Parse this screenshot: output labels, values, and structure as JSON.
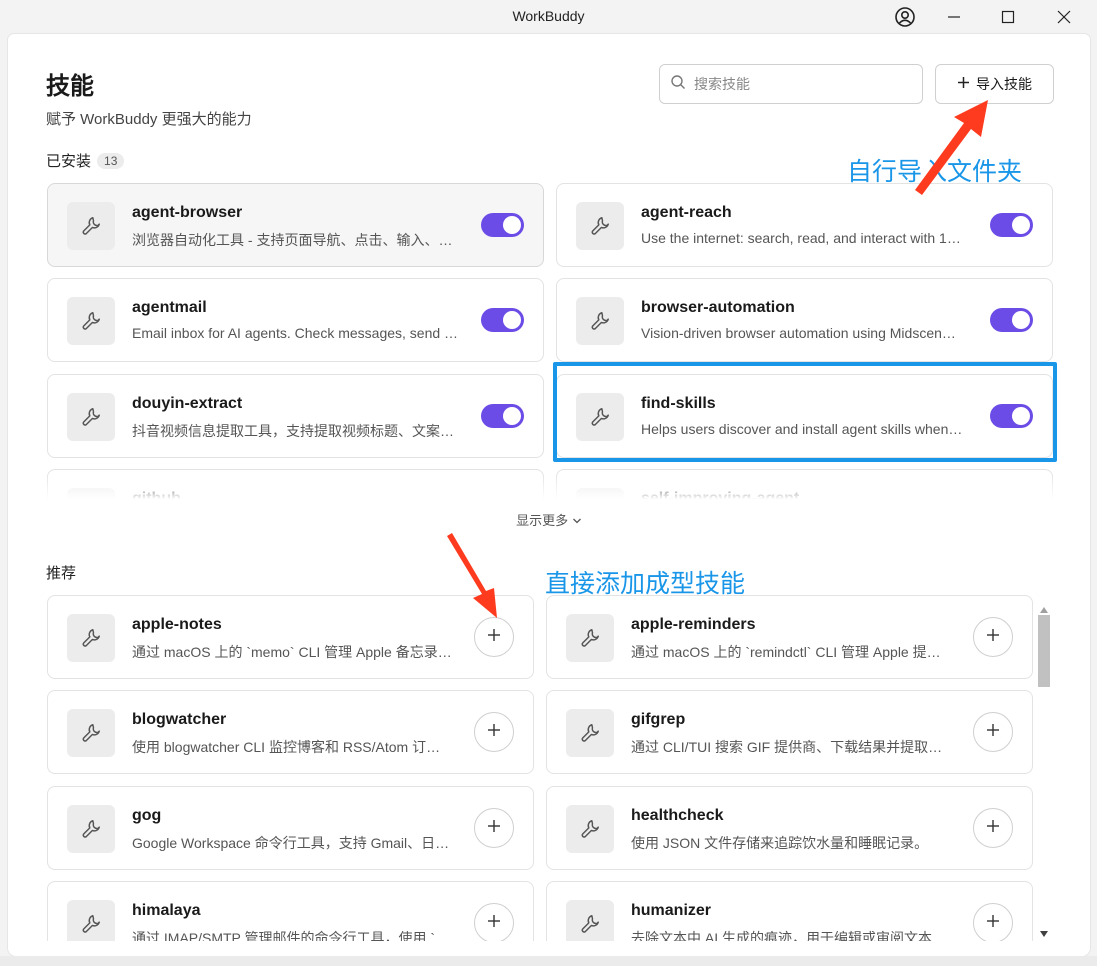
{
  "window": {
    "title": "WorkBuddy",
    "controls": [
      "account-icon",
      "minimize-icon",
      "maximize-icon",
      "close-icon"
    ]
  },
  "page": {
    "title": "技能",
    "subtitle": "赋予 WorkBuddy 更强大的能力"
  },
  "search": {
    "placeholder": "搜索技能",
    "value": ""
  },
  "import_button": {
    "label": "导入技能",
    "icon": "plus-icon"
  },
  "installed": {
    "label": "已安装",
    "count": "13",
    "items": [
      {
        "name": "agent-browser",
        "desc": "浏览器自动化工具 - 支持页面导航、点击、输入、…",
        "enabled": true
      },
      {
        "name": "agent-reach",
        "desc": "Use the internet: search, read, and interact with 1…",
        "enabled": true
      },
      {
        "name": "agentmail",
        "desc": "Email inbox for AI agents. Check messages, send …",
        "enabled": true
      },
      {
        "name": "browser-automation",
        "desc": "Vision-driven browser automation using Midscen…",
        "enabled": true
      },
      {
        "name": "douyin-extract",
        "desc": "抖音视频信息提取工具，支持提取视频标题、文案…",
        "enabled": true
      },
      {
        "name": "find-skills",
        "desc": "Helps users discover and install agent skills when…",
        "enabled": true
      },
      {
        "name": "github",
        "desc": "",
        "enabled": true
      },
      {
        "name": "self-improving-agent",
        "desc": "",
        "enabled": true
      }
    ]
  },
  "show_more": {
    "label": "显示更多"
  },
  "recommended": {
    "label": "推荐",
    "items": [
      {
        "name": "apple-notes",
        "desc": "通过 macOS 上的 `memo` CLI 管理 Apple 备忘录…"
      },
      {
        "name": "apple-reminders",
        "desc": "通过 macOS 上的 `remindctl` CLI 管理 Apple 提…"
      },
      {
        "name": "blogwatcher",
        "desc": "使用 blogwatcher CLI 监控博客和 RSS/Atom 订…"
      },
      {
        "name": "gifgrep",
        "desc": "通过 CLI/TUI 搜索 GIF 提供商、下载结果并提取…"
      },
      {
        "name": "gog",
        "desc": "Google Workspace 命令行工具，支持 Gmail、日…"
      },
      {
        "name": "healthcheck",
        "desc": "使用 JSON 文件存储来追踪饮水量和睡眠记录。"
      },
      {
        "name": "himalaya",
        "desc": "通过 IMAP/SMTP 管理邮件的命令行工具，使用 `…"
      },
      {
        "name": "humanizer",
        "desc": "去除文本中 AI 生成的痕迹，用于编辑或审阅文本…"
      }
    ]
  },
  "annotations": {
    "import_note": "自行导入文件夹",
    "add_note": "直接添加成型技能",
    "color": "#1a96e8",
    "arrow_color": "#ff3b1f"
  },
  "colors": {
    "toggle_on": "#6b4ce6",
    "accent": "#1a96e8"
  }
}
